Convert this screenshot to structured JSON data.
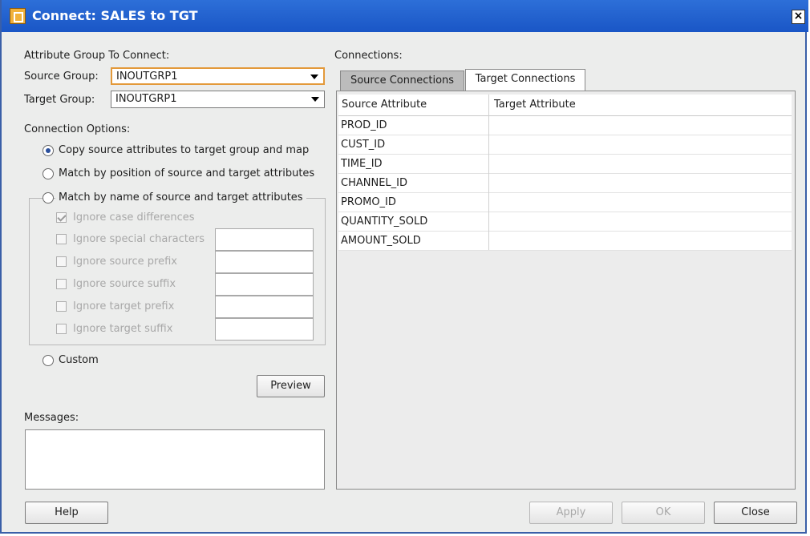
{
  "window": {
    "title": "Connect: SALES to TGT",
    "close_glyph": "×"
  },
  "left": {
    "attr_group_heading": "Attribute Group To Connect:",
    "source_group_label": "Source Group:",
    "source_group_value": "INOUTGRP1",
    "target_group_label": "Target Group:",
    "target_group_value": "INOUTGRP1",
    "conn_options_heading": "Connection Options:",
    "opt_copy": "Copy source attributes to target group and map",
    "opt_position": "Match by position of source and target attributes",
    "opt_name": "Match by name of source and target attributes",
    "chk_case": "Ignore case differences",
    "chk_special": "Ignore special characters",
    "chk_src_prefix": "Ignore source prefix",
    "chk_src_suffix": "Ignore source suffix",
    "chk_tgt_prefix": "Ignore target prefix",
    "chk_tgt_suffix": "Ignore target suffix",
    "opt_custom": "Custom",
    "preview_label": "Preview",
    "messages_heading": "Messages:"
  },
  "right": {
    "connections_heading": "Connections:",
    "tabs": [
      {
        "label": "Source Connections"
      },
      {
        "label": "Target Connections"
      }
    ],
    "columns": [
      "Source Attribute",
      "Target Attribute"
    ],
    "rows": [
      {
        "source": "PROD_ID",
        "target": ""
      },
      {
        "source": "CUST_ID",
        "target": ""
      },
      {
        "source": "TIME_ID",
        "target": ""
      },
      {
        "source": "CHANNEL_ID",
        "target": ""
      },
      {
        "source": "PROMO_ID",
        "target": ""
      },
      {
        "source": "QUANTITY_SOLD",
        "target": ""
      },
      {
        "source": "AMOUNT_SOLD",
        "target": ""
      }
    ]
  },
  "footer": {
    "help": "Help",
    "apply": "Apply",
    "ok": "OK",
    "close": "Close"
  }
}
